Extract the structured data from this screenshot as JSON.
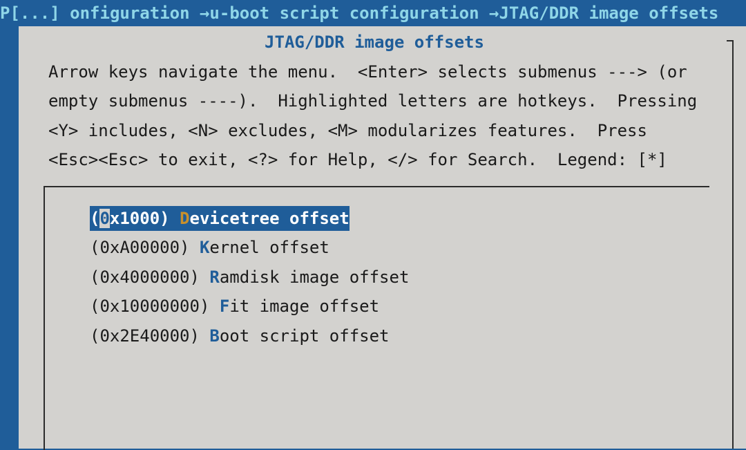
{
  "colors": {
    "background": "#1f5d99",
    "dialog": "#d3d2cf",
    "accent": "#1f5d99",
    "hotkey_selected": "#c8902c",
    "breadcrumb_text": "#8fd6e8"
  },
  "breadcrumb": "P[...] onfiguration →u-boot script configuration →JTAG/DDR image offsets",
  "dialog": {
    "title": "JTAG/DDR image offsets",
    "help_lines": [
      "Arrow keys navigate the menu.  <Enter> selects submenus ---> (or",
      "empty submenus ----).  Highlighted letters are hotkeys.  Pressing",
      "<Y> includes, <N> excludes, <M> modularizes features.  Press",
      "<Esc><Esc> to exit, <?> for Help, </> for Search.  Legend: [*]"
    ]
  },
  "menu": {
    "items": [
      {
        "value": "0x1000",
        "hotkey": "D",
        "rest": "evicetree offset",
        "selected": true
      },
      {
        "value": "0xA00000",
        "hotkey": "K",
        "rest": "ernel offset",
        "selected": false
      },
      {
        "value": "0x4000000",
        "hotkey": "R",
        "rest": "amdisk image offset",
        "selected": false
      },
      {
        "value": "0x10000000",
        "hotkey": "F",
        "rest": "it image offset",
        "selected": false
      },
      {
        "value": "0x2E40000",
        "hotkey": "B",
        "rest": "oot script offset",
        "selected": false
      }
    ]
  }
}
